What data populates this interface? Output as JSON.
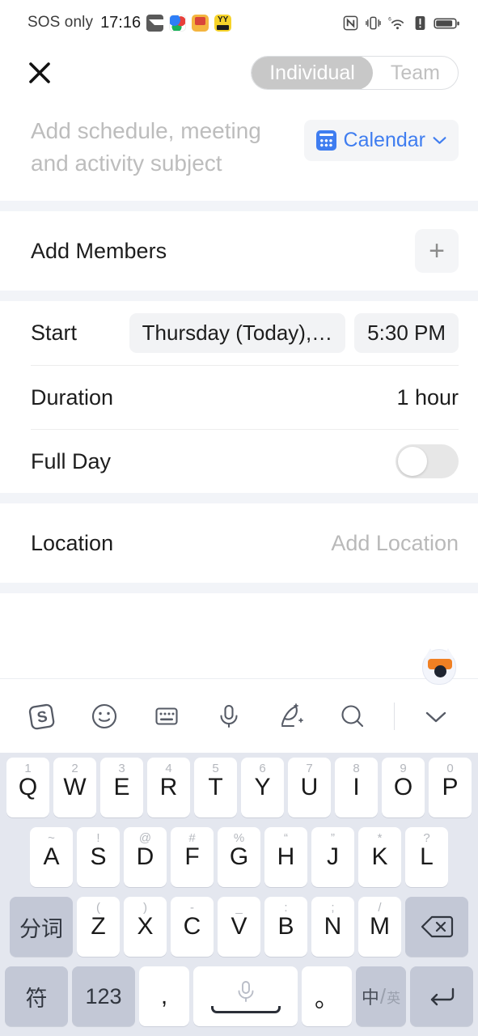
{
  "status_bar": {
    "carrier": "SOS only",
    "time": "17:16",
    "app_icons": [
      "mail-icon",
      "swirl-app-icon",
      "orange-app-icon",
      "yy-app-icon"
    ],
    "right_icons": [
      "nfc-icon",
      "vibrate-icon",
      "wifi-6-icon",
      "alert-icon",
      "battery-icon"
    ]
  },
  "header": {
    "close_label": "✕",
    "segmented": {
      "options": [
        "Individual",
        "Team"
      ],
      "selected": "Individual"
    }
  },
  "subject": {
    "placeholder": "Add schedule, meeting and activity subject",
    "value": "",
    "calendar_button": {
      "label": "Calendar",
      "icon": "calendar-icon",
      "chevron": "chevron-down-icon",
      "color": "#3f7df0"
    }
  },
  "members": {
    "label": "Add Members",
    "add_icon": "plus-icon"
  },
  "schedule": {
    "start": {
      "label": "Start",
      "date_chip": "Thursday (Today),…",
      "time_chip": "5:30 PM"
    },
    "duration": {
      "label": "Duration",
      "value": "1 hour"
    },
    "full_day": {
      "label": "Full Day",
      "enabled": false
    }
  },
  "location": {
    "label": "Location",
    "placeholder": "Add Location"
  },
  "keyboard": {
    "toolbar": {
      "mascot": "fox-mascot-icon",
      "items": [
        {
          "name": "sogou-logo-icon",
          "label": "S"
        },
        {
          "name": "emoji-icon",
          "label": ""
        },
        {
          "name": "keyboard-icon",
          "label": ""
        },
        {
          "name": "microphone-icon",
          "label": ""
        },
        {
          "name": "ai-writing-icon",
          "label": ""
        },
        {
          "name": "search-icon",
          "label": ""
        },
        {
          "name": "collapse-keyboard-icon",
          "label": ""
        }
      ]
    },
    "row1": [
      {
        "key": "Q",
        "hint": "1"
      },
      {
        "key": "W",
        "hint": "2"
      },
      {
        "key": "E",
        "hint": "3"
      },
      {
        "key": "R",
        "hint": "4"
      },
      {
        "key": "T",
        "hint": "5"
      },
      {
        "key": "Y",
        "hint": "6"
      },
      {
        "key": "U",
        "hint": "7"
      },
      {
        "key": "I",
        "hint": "8"
      },
      {
        "key": "O",
        "hint": "9"
      },
      {
        "key": "P",
        "hint": "0"
      }
    ],
    "row2": [
      {
        "key": "A",
        "hint": "~"
      },
      {
        "key": "S",
        "hint": "!"
      },
      {
        "key": "D",
        "hint": "@"
      },
      {
        "key": "F",
        "hint": "#"
      },
      {
        "key": "G",
        "hint": "%"
      },
      {
        "key": "H",
        "hint": "“"
      },
      {
        "key": "J",
        "hint": "”"
      },
      {
        "key": "K",
        "hint": "*"
      },
      {
        "key": "L",
        "hint": "?"
      }
    ],
    "row3": {
      "left_fn": "分词",
      "letters": [
        {
          "key": "Z",
          "hint": "("
        },
        {
          "key": "X",
          "hint": ")"
        },
        {
          "key": "C",
          "hint": "-"
        },
        {
          "key": "V",
          "hint": "_"
        },
        {
          "key": "B",
          "hint": ":"
        },
        {
          "key": "N",
          "hint": ";"
        },
        {
          "key": "M",
          "hint": "/"
        }
      ],
      "backspace": "backspace-icon"
    },
    "row4": {
      "symbols": "符",
      "numbers": "123",
      "comma": ",",
      "space": "space-bar",
      "period": "。",
      "lang_top": "中",
      "lang_bottom": "英",
      "enter": "enter-icon"
    }
  }
}
